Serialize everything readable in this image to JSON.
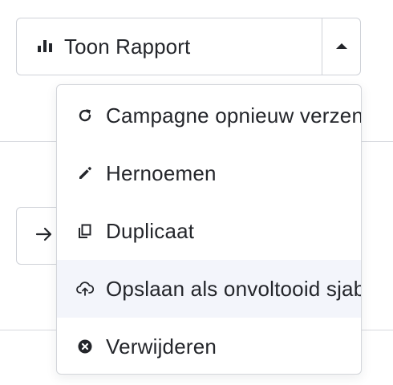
{
  "split_button": {
    "label": "Toon Rapport",
    "icon": "bar-chart-icon",
    "toggle_icon": "caret-up-icon"
  },
  "background_button": {
    "icon": "arrow-right-icon"
  },
  "menu": {
    "items": [
      {
        "label": "Campagne opnieuw verzenden",
        "icon": "refresh-icon"
      },
      {
        "label": "Hernoemen",
        "icon": "pencil-icon"
      },
      {
        "label": "Duplicaat",
        "icon": "duplicate-icon"
      },
      {
        "label": "Opslaan als onvoltooid sjabloon",
        "icon": "cloud-upload-icon"
      },
      {
        "label": "Verwijderen",
        "icon": "remove-circle-icon"
      }
    ],
    "highlighted_index": 3
  },
  "colors": {
    "text": "#24262b",
    "border": "#cfd2d8",
    "hover_bg": "#f3f5fb"
  }
}
